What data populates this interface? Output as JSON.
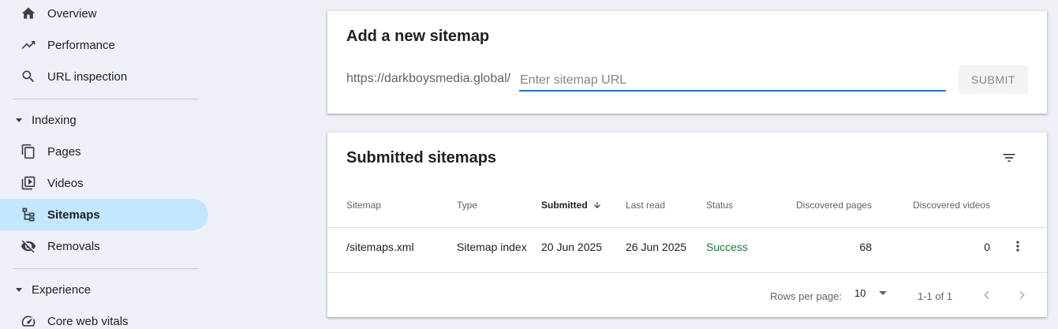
{
  "sidebar": {
    "items": [
      {
        "label": "Overview",
        "icon": "home-icon"
      },
      {
        "label": "Performance",
        "icon": "trending-up-icon"
      },
      {
        "label": "URL inspection",
        "icon": "search-icon"
      }
    ],
    "indexing": {
      "heading": "Indexing",
      "items": [
        {
          "label": "Pages",
          "icon": "pages-icon"
        },
        {
          "label": "Videos",
          "icon": "videos-icon"
        },
        {
          "label": "Sitemaps",
          "icon": "sitemap-icon",
          "active": true
        },
        {
          "label": "Removals",
          "icon": "removals-icon"
        }
      ]
    },
    "experience": {
      "heading": "Experience",
      "items": [
        {
          "label": "Core web vitals",
          "icon": "gauge-icon"
        }
      ]
    }
  },
  "add_sitemap": {
    "title": "Add a new sitemap",
    "prefix": "https://darkboysmedia.global/",
    "input_value": "",
    "placeholder": "Enter sitemap URL",
    "submit_label": "SUBMIT"
  },
  "submitted": {
    "title": "Submitted sitemaps",
    "columns": [
      "Sitemap",
      "Type",
      "Submitted",
      "Last read",
      "Status",
      "Discovered pages",
      "Discovered videos"
    ],
    "sorted_column": "Submitted",
    "rows": [
      {
        "sitemap": "/sitemaps.xml",
        "type": "Sitemap index",
        "submitted": "20 Jun 2025",
        "last_read": "26 Jun 2025",
        "status": "Success",
        "discovered_pages": "68",
        "discovered_videos": "0"
      }
    ],
    "footer": {
      "rows_per_page_label": "Rows per page:",
      "rows_per_page_value": "10",
      "range_label": "1-1 of 1"
    }
  },
  "colors": {
    "background": "#eef0f8",
    "active_nav": "#c2e7ff",
    "input_underline": "#1a73e8",
    "status_success": "#188038"
  }
}
